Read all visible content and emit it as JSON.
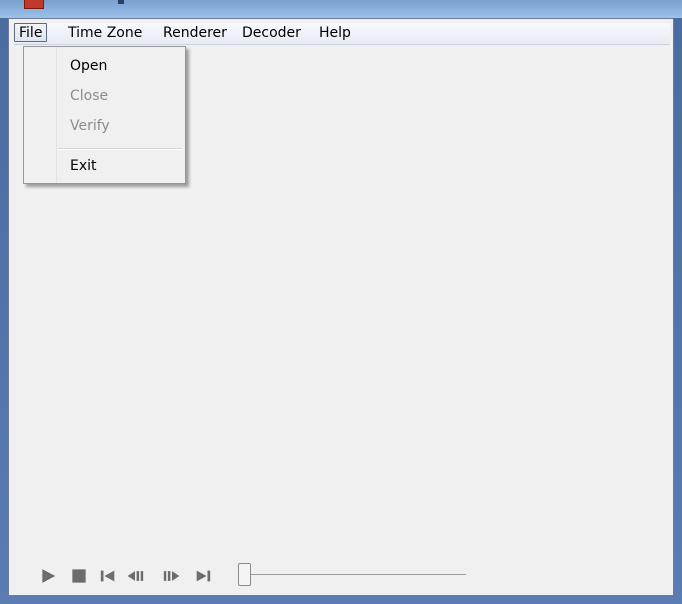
{
  "menubar": {
    "items": [
      {
        "label": "File"
      },
      {
        "label": "Time Zone"
      },
      {
        "label": "Renderer"
      },
      {
        "label": "Decoder"
      },
      {
        "label": "Help"
      }
    ]
  },
  "file_menu": {
    "items": [
      {
        "label": "Open",
        "enabled": true
      },
      {
        "label": "Close",
        "enabled": false
      },
      {
        "label": "Verify",
        "enabled": false
      },
      {
        "label": "Exit",
        "enabled": true
      }
    ]
  },
  "transport": {
    "buttons": [
      "play-icon",
      "stop-icon",
      "skip-to-start-icon",
      "step-back-icon",
      "step-forward-icon",
      "skip-to-end-icon"
    ],
    "icon_color": "#6d6d6d",
    "seek_position": 0
  },
  "colors": {
    "window_frame": "#5b7bb3",
    "client_background": "#f0f0f0",
    "disabled_text": "#8c8c8c"
  }
}
